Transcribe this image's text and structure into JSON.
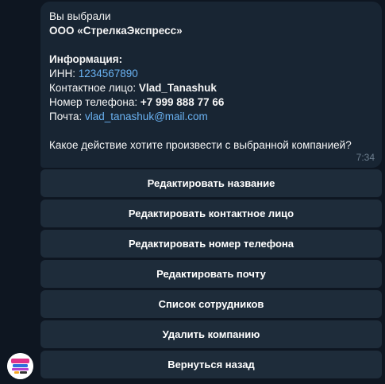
{
  "message": {
    "line1": "Вы выбрали",
    "company_name": "ООО «СтрелкаЭкспресс»",
    "info_heading": "Информация:",
    "inn_label": "ИНН: ",
    "inn_value": "1234567890",
    "contact_label": "Контактное лицо: ",
    "contact_value": "Vlad_Tanashuk",
    "phone_label": "Номер телефона: ",
    "phone_value": "+7 999 888 77 66",
    "email_label": "Почта: ",
    "email_value": "vlad_tanashuk@mail.com",
    "question": "Какое действие хотите произвести с выбранной компанией?",
    "time": "7:34"
  },
  "keyboard": {
    "buttons": [
      "Редактировать название",
      "Редактировать контактное лицо",
      "Редактировать номер телефона",
      "Редактировать почту",
      "Список сотрудников",
      "Удалить компанию",
      "Вернуться назад"
    ]
  },
  "colors": {
    "background": "#0e1621",
    "bubble": "#182533",
    "button": "#1e2c3a",
    "link": "#6ab2f2"
  },
  "avatar_icon": "bot-logo-icon"
}
